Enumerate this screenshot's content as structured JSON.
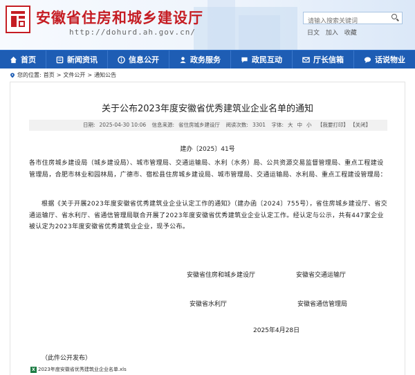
{
  "header": {
    "site_title": "安徽省住房和城乡建设厅",
    "site_url": "http://dohurd.ah.gov.cn/",
    "search_placeholder": "请输入搜索关键词",
    "top_links": [
      "日文",
      "加入",
      "收藏"
    ]
  },
  "nav": {
    "items": [
      {
        "label": "首页",
        "icon": "home-icon"
      },
      {
        "label": "新闻资讯",
        "icon": "news-icon"
      },
      {
        "label": "信息公开",
        "icon": "info-icon"
      },
      {
        "label": "政务服务",
        "icon": "service-icon"
      },
      {
        "label": "政民互动",
        "icon": "interaction-icon"
      },
      {
        "label": "厅长信箱",
        "icon": "mailbox-icon"
      },
      {
        "label": "话说物业",
        "icon": "chat-icon"
      }
    ]
  },
  "breadcrumb": {
    "prefix": "您的位置:",
    "items": [
      "首页",
      "文件公开",
      "通知公告"
    ],
    "separator": ">"
  },
  "article": {
    "title": "关于公布2023年度安徽省优秀建筑业企业名单的通知",
    "meta": {
      "date_label": "日期:",
      "date": "2025-04-30 10:06",
      "source_label": "信息来源:",
      "source": "省住房城乡建设厅",
      "views_label": "阅读次数:",
      "views": "3301",
      "font_label": "字体:",
      "font_sizes": [
        "大",
        "中",
        "小"
      ],
      "print": "【我要打印】",
      "close": "【关闭】"
    },
    "doc_number": "建办〔2025〕41号",
    "para1": "各市住房城乡建设局（城乡建设局）、城市管理局、交通运输局、水利（水务）局、公共资源交易监督管理局、重点工程建设管理局，合肥市林业和园林局，广德市、宿松县住房城乡建设局、城市管理局、交通运输局、水利局、重点工程建设管理局：",
    "para2": "根据《关于开展2023年度安徽省优秀建筑业企业认定工作的通知》（建办函〔2024〕755号），省住房城乡建设厅、省交通运输厅、省水利厅、省通信管理局联合开展了2023年度安徽省优秀建筑业企业认定工作。经认定与公示，共有447家企业被认定为2023年度安徽省优秀建筑业企业，现予公布。",
    "signatories": [
      "安徽省住房和城乡建设厅",
      "安徽省交通运输厅",
      "安徽省水利厅",
      "安徽省通信管理局"
    ],
    "sign_date": "2025年4月28日",
    "footnote": "（此件公开发布）",
    "attachment": "2023年度安徽省优秀建筑业企业名单.xls"
  }
}
